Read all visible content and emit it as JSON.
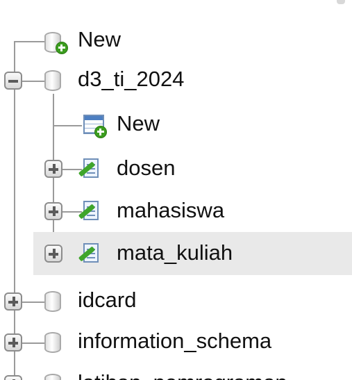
{
  "tree": {
    "root_new": {
      "label": "New",
      "icon": "new-database-icon"
    },
    "databases": [
      {
        "name": "d3_ti_2024",
        "expanded": true,
        "icon": "database-icon",
        "children": [
          {
            "label": "New",
            "icon": "new-table-icon"
          },
          {
            "label": "dosen",
            "icon": "table-structure-icon",
            "expanded": false
          },
          {
            "label": "mahasiswa",
            "icon": "table-structure-icon",
            "expanded": false
          },
          {
            "label": "mata_kuliah",
            "icon": "table-structure-icon",
            "expanded": false,
            "highlighted": true
          }
        ]
      },
      {
        "name": "idcard",
        "expanded": false,
        "icon": "database-icon"
      },
      {
        "name": "information_schema",
        "expanded": false,
        "icon": "database-icon"
      },
      {
        "name": "latihan_pemrograman",
        "expanded": false,
        "icon": "database-icon"
      }
    ]
  },
  "colors": {
    "highlight": "#e9e9e9",
    "tree_line": "#9a9a9a",
    "badge_green": "#3c9d1f"
  }
}
